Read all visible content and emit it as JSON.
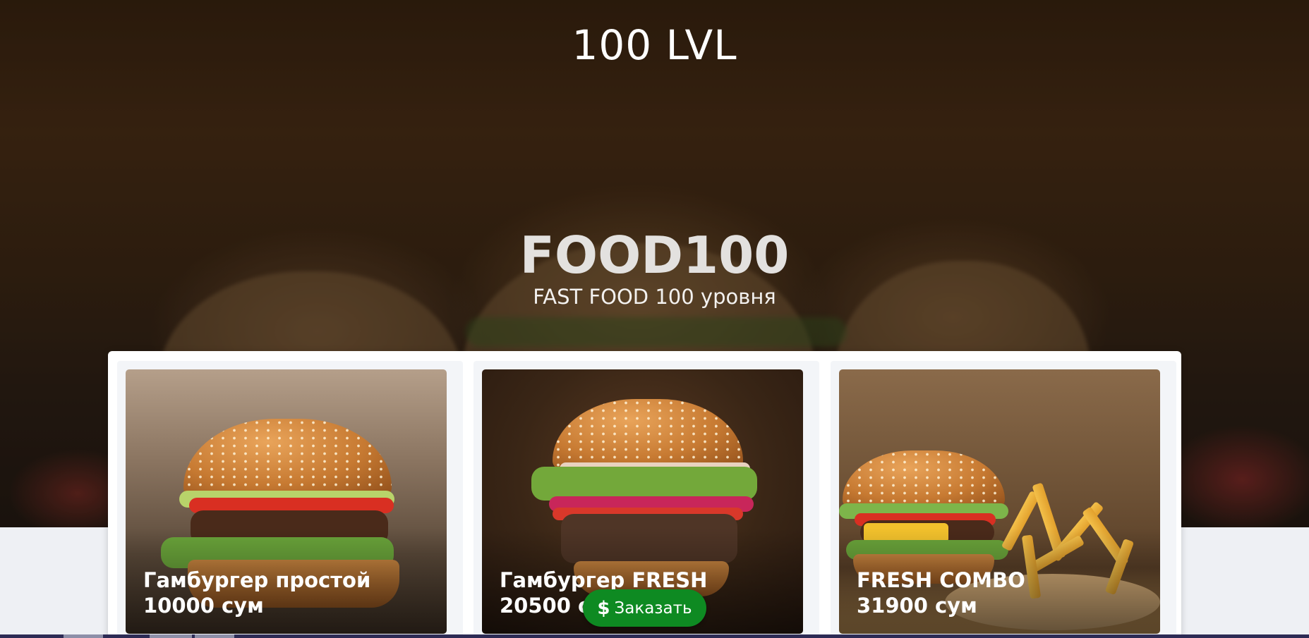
{
  "header": {
    "site_name": "100 LVL"
  },
  "hero": {
    "title": "FOOD100",
    "subtitle": "FAST FOOD 100 уровня"
  },
  "products": [
    {
      "name": "Гамбургер простой",
      "price": "10000 сум"
    },
    {
      "name": "Гамбургер FRESH",
      "price": "20500 сум"
    },
    {
      "name": "FRESH COMBO",
      "price": "31900 сум"
    }
  ],
  "order_button": {
    "icon": "$",
    "label": "Заказать",
    "color": "#0e8a22"
  },
  "colors": {
    "hero": "#3a2410",
    "panel": "#ffffff",
    "page": "#eef0f4"
  },
  "icons": [
    "dollar-icon"
  ]
}
